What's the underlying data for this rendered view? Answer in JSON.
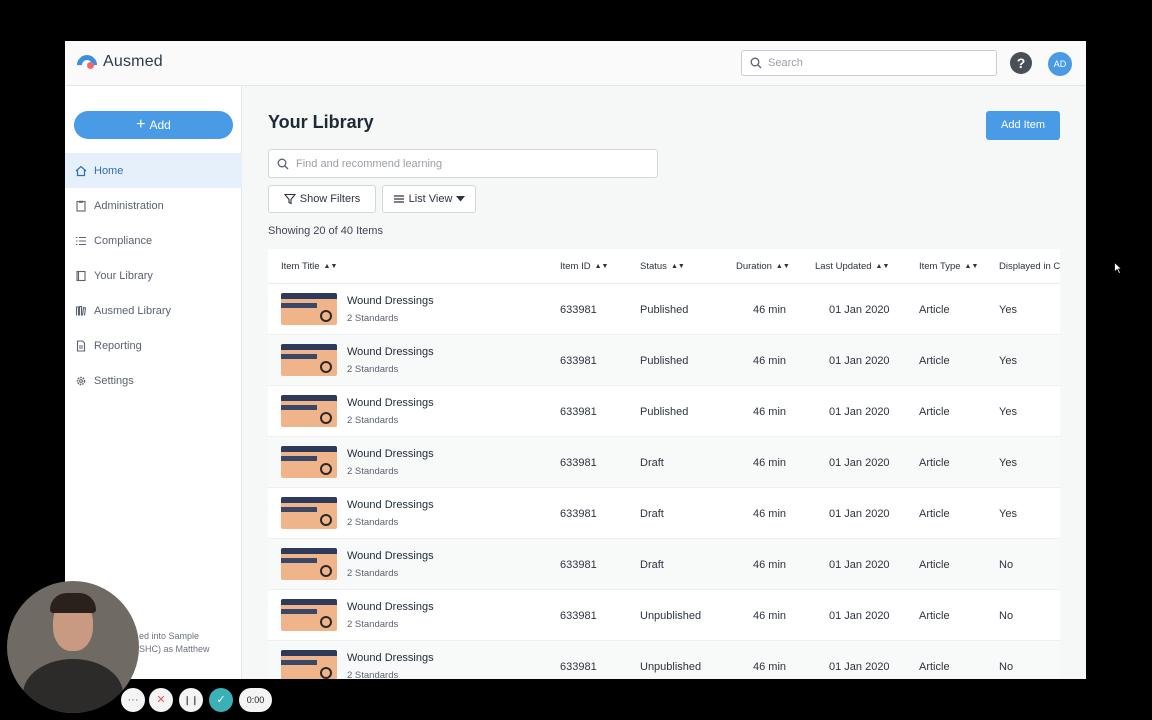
{
  "app": {
    "name": "Ausmed"
  },
  "topbar": {
    "search_placeholder": "Search",
    "help_label": "?",
    "avatar_initials": "AD"
  },
  "sidebar": {
    "add_label": "Add",
    "items": [
      {
        "label": "Home",
        "icon": "home-icon",
        "active": true
      },
      {
        "label": "Administration",
        "icon": "clipboard-icon"
      },
      {
        "label": "Compliance",
        "icon": "list-icon"
      },
      {
        "label": "Your Library",
        "icon": "book-icon"
      },
      {
        "label": "Ausmed Library",
        "icon": "library-icon"
      },
      {
        "label": "Reporting",
        "icon": "report-icon"
      },
      {
        "label": "Settings",
        "icon": "gear-icon"
      }
    ],
    "logged_in_line1": "ed into Sample",
    "logged_in_line2": "SHC) as Matthew"
  },
  "main": {
    "title": "Your Library",
    "add_item_label": "Add Item",
    "search_placeholder": "Find and recommend learning",
    "filter_label": "Show Filters",
    "view_label": "List View",
    "showing_text": "Showing 20 of 40 Items"
  },
  "table": {
    "columns": [
      "Item Title",
      "Item ID",
      "Status",
      "Duration",
      "Last Updated",
      "Item Type",
      "Displayed in C"
    ],
    "rows": [
      {
        "title": "Wound Dressings",
        "standards": "2 Standards",
        "id": "633981",
        "status": "Published",
        "duration": "46 min",
        "updated": "01 Jan 2020",
        "type": "Article",
        "displayed": "Yes"
      },
      {
        "title": "Wound Dressings",
        "standards": "2 Standards",
        "id": "633981",
        "status": "Published",
        "duration": "46 min",
        "updated": "01 Jan 2020",
        "type": "Article",
        "displayed": "Yes"
      },
      {
        "title": "Wound Dressings",
        "standards": "2 Standards",
        "id": "633981",
        "status": "Published",
        "duration": "46 min",
        "updated": "01 Jan 2020",
        "type": "Article",
        "displayed": "Yes"
      },
      {
        "title": "Wound Dressings",
        "standards": "2 Standards",
        "id": "633981",
        "status": "Draft",
        "duration": "46 min",
        "updated": "01 Jan 2020",
        "type": "Article",
        "displayed": "Yes"
      },
      {
        "title": "Wound Dressings",
        "standards": "2 Standards",
        "id": "633981",
        "status": "Draft",
        "duration": "46 min",
        "updated": "01 Jan 2020",
        "type": "Article",
        "displayed": "Yes"
      },
      {
        "title": "Wound Dressings",
        "standards": "2 Standards",
        "id": "633981",
        "status": "Draft",
        "duration": "46 min",
        "updated": "01 Jan 2020",
        "type": "Article",
        "displayed": "No"
      },
      {
        "title": "Wound Dressings",
        "standards": "2 Standards",
        "id": "633981",
        "status": "Unpublished",
        "duration": "46 min",
        "updated": "01 Jan 2020",
        "type": "Article",
        "displayed": "No"
      },
      {
        "title": "Wound Dressings",
        "standards": "2 Standards",
        "id": "633981",
        "status": "Unpublished",
        "duration": "46 min",
        "updated": "01 Jan 2020",
        "type": "Article",
        "displayed": "No"
      }
    ]
  },
  "recorder": {
    "timer": "0:00",
    "more_label": "···",
    "cancel_label": "✕",
    "pause_label": "❙❙",
    "done_label": "✓"
  }
}
